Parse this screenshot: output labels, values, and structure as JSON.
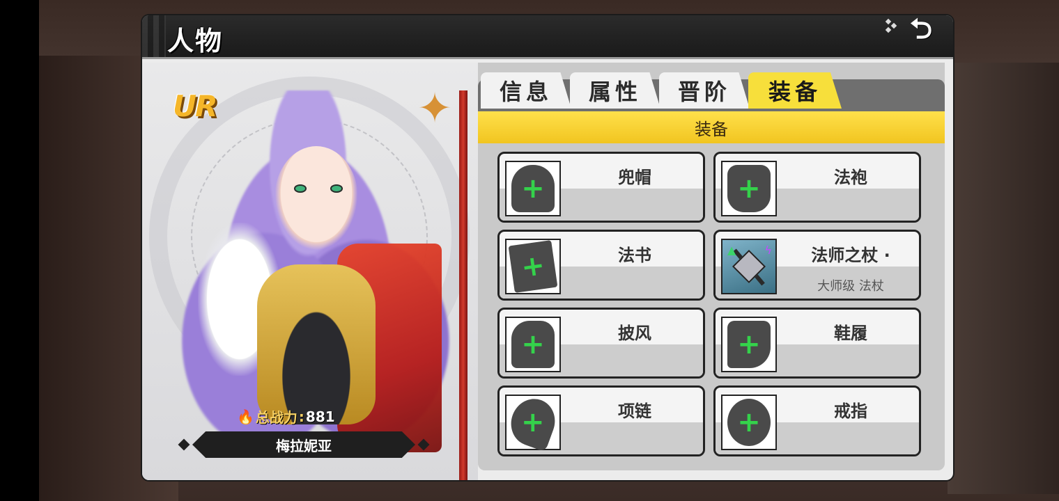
{
  "header": {
    "title": "人物",
    "back_icon": "back-arrow-icon"
  },
  "hero": {
    "rarity": "UR",
    "power_label": "总战力",
    "power_value": "881",
    "name": "梅拉妮亚"
  },
  "tabs": [
    {
      "label": "信息",
      "active": false
    },
    {
      "label": "属性",
      "active": false
    },
    {
      "label": "晋阶",
      "active": false
    },
    {
      "label": "装备",
      "active": true
    }
  ],
  "section_title": "装备",
  "slots": [
    {
      "name": "兜帽",
      "sub": "",
      "empty": true
    },
    {
      "name": "法袍",
      "sub": "",
      "empty": true
    },
    {
      "name": "法书",
      "sub": "",
      "empty": true
    },
    {
      "name": "法师之杖 ·",
      "sub": "大师级 法杖",
      "empty": false
    },
    {
      "name": "披风",
      "sub": "",
      "empty": true
    },
    {
      "name": "鞋履",
      "sub": "",
      "empty": true
    },
    {
      "name": "项链",
      "sub": "",
      "empty": true
    },
    {
      "name": "戒指",
      "sub": "",
      "empty": true
    }
  ],
  "colors": {
    "tab_active": "#f7df3b",
    "section_bar": "#ffe04b",
    "plus": "#34d24b"
  }
}
